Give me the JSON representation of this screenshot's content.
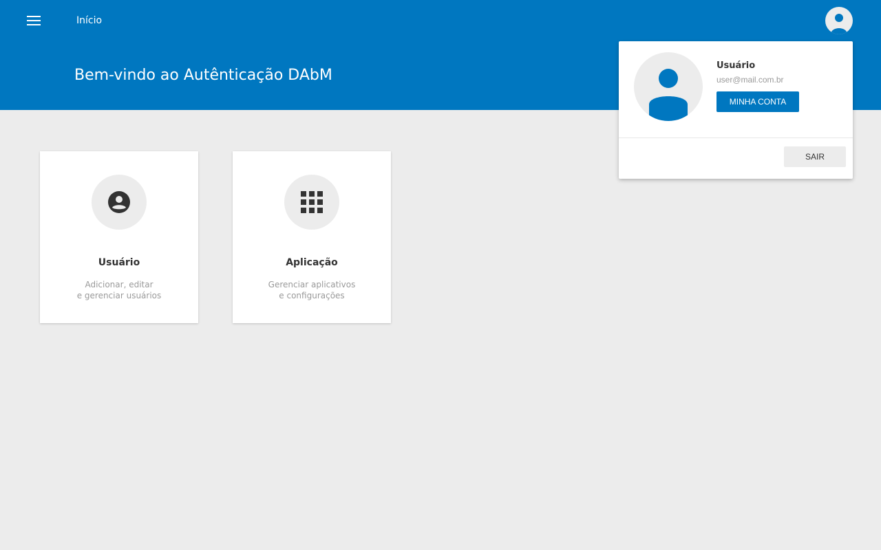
{
  "nav": {
    "menu_icon": "menu-icon",
    "title": "Início",
    "avatar_icon": "account-circle-icon"
  },
  "header": {
    "welcome": "Bem-vindo ao Autênticação DAbM"
  },
  "cards": [
    {
      "icon": "account-circle-icon",
      "title": "Usuário",
      "desc_line1": "Adicionar, editar",
      "desc_line2": "e gerenciar usuários"
    },
    {
      "icon": "apps-grid-icon",
      "title": "Aplicação",
      "desc_line1": "Gerenciar aplicativos",
      "desc_line2": "e configurações"
    }
  ],
  "user_popup": {
    "name": "Usuário",
    "email": "user@mail.com.br",
    "account_label": "MINHA CONTA",
    "logout_label": "SAIR"
  },
  "colors": {
    "primary": "#0077c0",
    "background": "#ececec",
    "card": "#ffffff",
    "icon_dark": "#333333",
    "muted_text": "#999999"
  }
}
